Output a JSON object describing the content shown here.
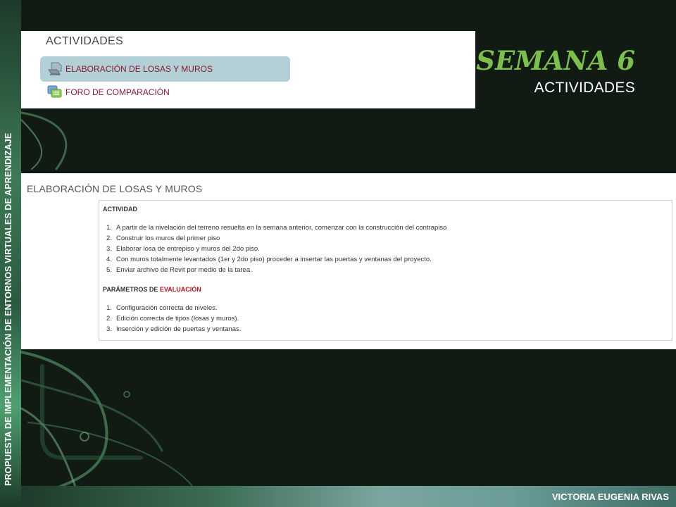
{
  "side_label": "PROPUESTA DE IMPLEMENTACIÓN DE ENTORNOS VIRTUALES DE APRENDIZAJE",
  "title": {
    "week": "SEMANA 6",
    "subtitle": "ACTIVIDADES",
    "accent_color": "#7cbf4a"
  },
  "activities_panel": {
    "heading": "ACTIVIDADES",
    "items": [
      {
        "label": "ELABORACIÓN DE LOSAS Y MUROS",
        "icon": "assignment-icon",
        "highlighted": true
      },
      {
        "label": "FORO DE COMPARACIÓN",
        "icon": "forum-icon",
        "highlighted": false
      }
    ]
  },
  "detail_panel": {
    "heading": "ELABORACIÓN DE LOSAS Y MUROS",
    "activity_heading": "ACTIVIDAD",
    "activity_steps": [
      "A partir de la nivelación del terreno resuelta en la semana anterior, comenzar con la construcción del contrapiso",
      "Construir los muros del primer piso",
      "Elaborar losa de entrepiso y muros del 2do piso.",
      "Con muros totalmente levantados (1er y 2do piso) proceder a insertar las puertas y ventanas del proyecto.",
      "Enviar archivo de Revit por medio de la tarea."
    ],
    "params_heading_prefix": "PARÁMETROS DE",
    "params_heading_highlight": "EVALUACIÓN",
    "params": [
      "Configuración correcta de niveles.",
      "Edición correcta de tipos (losas y muros).",
      "Inserción y edición de puertas y ventanas."
    ]
  },
  "footer": {
    "author": "VICTORIA EUGENIA RIVAS"
  }
}
